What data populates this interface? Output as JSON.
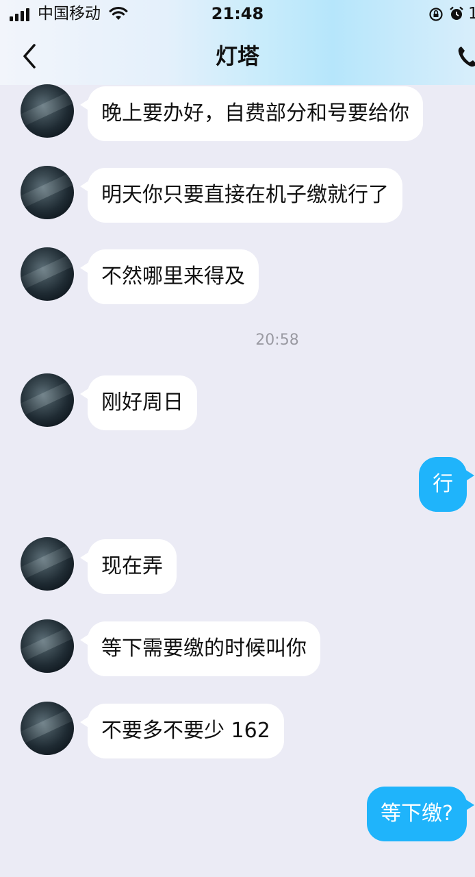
{
  "status_bar": {
    "carrier": "中国移动",
    "time": "21:48",
    "battery_percent": "1"
  },
  "header": {
    "title": "灯塔"
  },
  "messages": [
    {
      "side": "incoming",
      "text": "晚上要办好，自费部分和号要给你"
    },
    {
      "side": "incoming",
      "text": "明天你只要直接在机子缴就行了"
    },
    {
      "side": "incoming",
      "text": "不然哪里来得及"
    },
    {
      "type": "timestamp",
      "text": "20:58"
    },
    {
      "side": "incoming",
      "text": "刚好周日"
    },
    {
      "side": "outgoing",
      "text": "行"
    },
    {
      "side": "incoming",
      "text": "现在弄"
    },
    {
      "side": "incoming",
      "text": "等下需要缴的时候叫你"
    },
    {
      "side": "incoming",
      "text": "不要多不要少 162"
    },
    {
      "side": "outgoing",
      "text": "等下缴?"
    }
  ],
  "colors": {
    "outgoing_bubble": "#1fb4fb",
    "incoming_bubble": "#ffffff",
    "chat_background": "#ebebf5"
  }
}
